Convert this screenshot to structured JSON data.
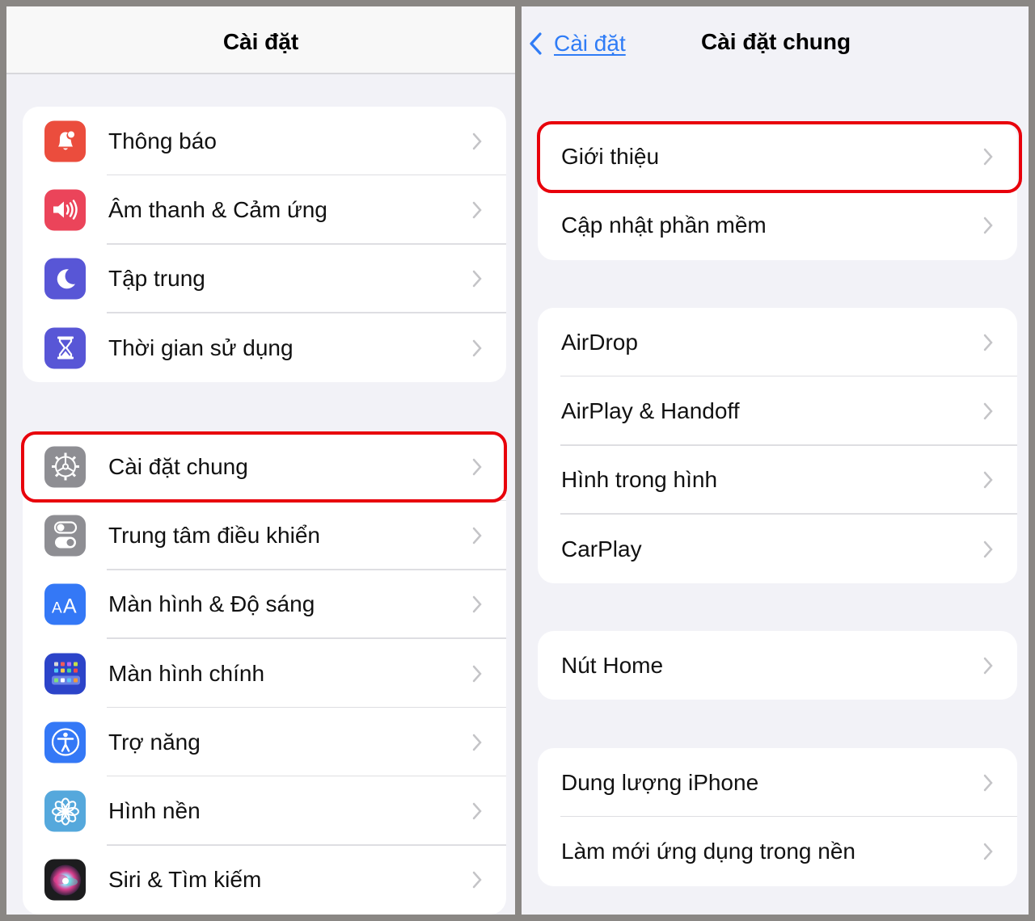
{
  "left_screen": {
    "title": "Cài đặt",
    "groups": [
      {
        "items": [
          {
            "label": "Thông báo",
            "icon": "notification-bell-icon",
            "color": "#eb4d3d"
          },
          {
            "label": "Âm thanh & Cảm ứng",
            "icon": "speaker-icon",
            "color": "#eb445a"
          },
          {
            "label": "Tập trung",
            "icon": "moon-icon",
            "color": "#5856d6"
          },
          {
            "label": "Thời gian sử dụng",
            "icon": "hourglass-icon",
            "color": "#5856d6"
          }
        ]
      },
      {
        "items": [
          {
            "label": "Cài đặt chung",
            "icon": "gear-icon",
            "color": "#8e8e93",
            "highlighted": true
          },
          {
            "label": "Trung tâm điều khiển",
            "icon": "toggle-switches-icon",
            "color": "#8e8e93"
          },
          {
            "label": "Màn hình & Độ sáng",
            "icon": "text-size-icon",
            "color": "#3478f6"
          },
          {
            "label": "Màn hình chính",
            "icon": "home-screen-grid-icon",
            "color": "#2c44c9"
          },
          {
            "label": "Trợ năng",
            "icon": "accessibility-icon",
            "color": "#3478f6"
          },
          {
            "label": "Hình nền",
            "icon": "wallpaper-flower-icon",
            "color": "#55a8dc"
          },
          {
            "label": "Siri & Tìm kiếm",
            "icon": "siri-icon",
            "color": "#1c1c1e"
          }
        ]
      }
    ]
  },
  "right_screen": {
    "back_label": "Cài đặt",
    "title": "Cài đặt chung",
    "groups": [
      {
        "items": [
          {
            "label": "Giới thiệu",
            "highlighted": true
          },
          {
            "label": "Cập nhật phần mềm"
          }
        ]
      },
      {
        "items": [
          {
            "label": "AirDrop"
          },
          {
            "label": "AirPlay & Handoff"
          },
          {
            "label": "Hình trong hình"
          },
          {
            "label": "CarPlay"
          }
        ]
      },
      {
        "items": [
          {
            "label": "Nút Home"
          }
        ]
      },
      {
        "items": [
          {
            "label": "Dung lượng iPhone"
          },
          {
            "label": "Làm mới ứng dụng trong nền"
          }
        ]
      }
    ]
  },
  "colors": {
    "highlight": "#e8000b",
    "accent": "#2f7cf6",
    "background": "#f2f2f7"
  }
}
